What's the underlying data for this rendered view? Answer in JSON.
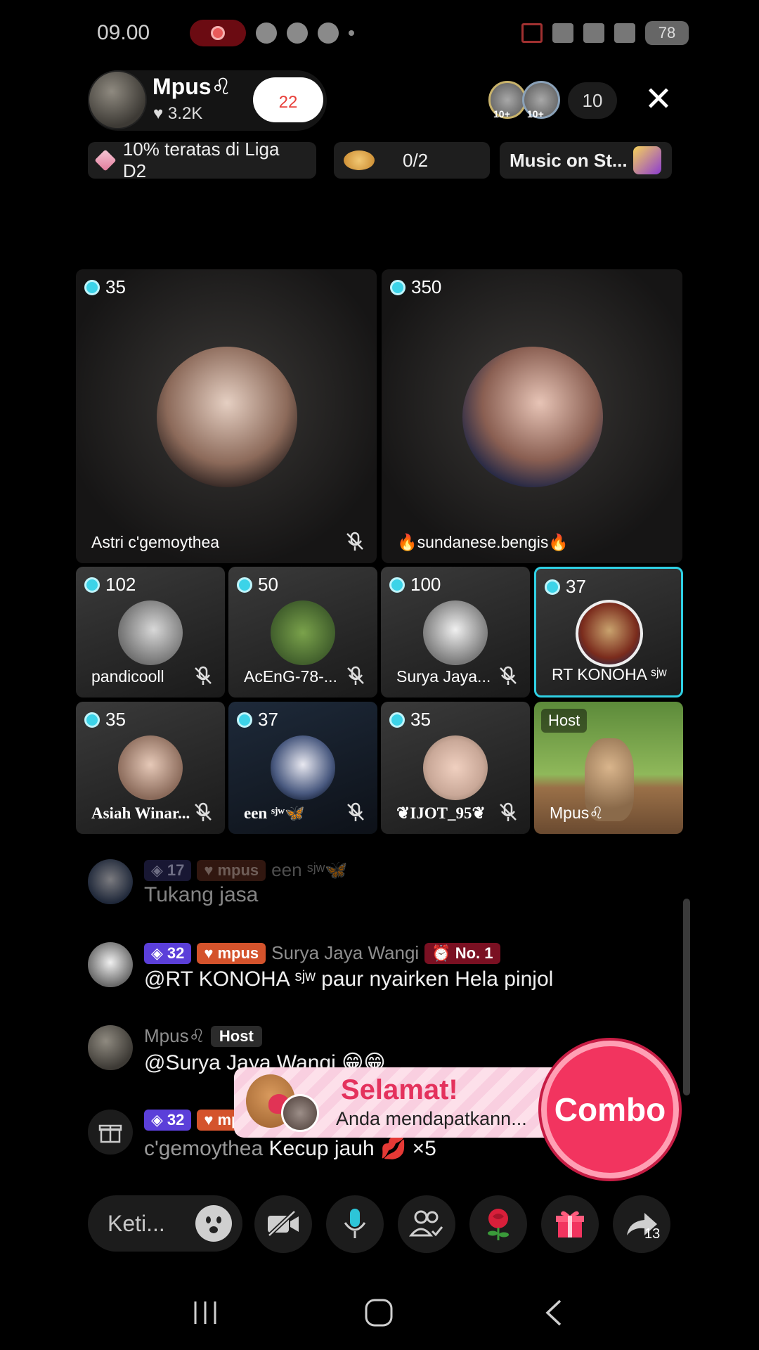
{
  "status_bar": {
    "time": "09.00",
    "battery": "78"
  },
  "header": {
    "host_name": "Mpus♌",
    "host_likes": "3.2K",
    "follow_count": "22",
    "viewer_badge": "10+",
    "viewer_count": "10"
  },
  "chips": {
    "league": "10% teratas di Liga D2",
    "planet_progress": "0/2",
    "music": "Music on St..."
  },
  "guests": [
    {
      "count": "35",
      "name": "Astri c'gemoythea"
    },
    {
      "count": "350",
      "name": "🔥sundanese.bengis🔥"
    },
    {
      "count": "102",
      "name": "pandicooll"
    },
    {
      "count": "50",
      "name": "AcEnG-78-..."
    },
    {
      "count": "100",
      "name": "Surya Jaya..."
    },
    {
      "count": "37",
      "name": "RT KONOHA ˢʲʷ"
    },
    {
      "count": "35",
      "name": "Asiah Winar..."
    },
    {
      "count": "37",
      "name": "een ˢʲʷ🦋"
    },
    {
      "count": "35",
      "name": "❦IJOT_95❦"
    },
    {
      "host_label": "Host",
      "name": "Mpus♌"
    }
  ],
  "chat": [
    {
      "level": "17",
      "fan": "mpus",
      "user": "een ˢʲʷ🦋",
      "text": "Tukang jasa"
    },
    {
      "level": "32",
      "fan": "mpus",
      "user": "Surya Jaya Wangi",
      "rank": "No. 1",
      "text": "@RT KONOHA ˢʲʷ paur nyairken Hela pinjol"
    },
    {
      "user": "Mpus♌",
      "host_badge": "Host",
      "text": "@Surya Jaya Wangi 😁😁"
    },
    {
      "level": "32",
      "fan": "mpus",
      "user": "c'gemoythea",
      "text": "Kecup jauh 💋 ×5"
    }
  ],
  "congrats": {
    "title": "Selamat!",
    "subtitle": "Anda mendapatkann..."
  },
  "combo_label": "Combo",
  "input": {
    "placeholder": "Keti..."
  },
  "share_count": "13",
  "colors": {
    "accent": "#f2345f",
    "coin": "#3cd3e8",
    "active_border": "#2fd0e4",
    "level_badge": "#5b3fd9",
    "fan_badge": "#d4532c"
  }
}
